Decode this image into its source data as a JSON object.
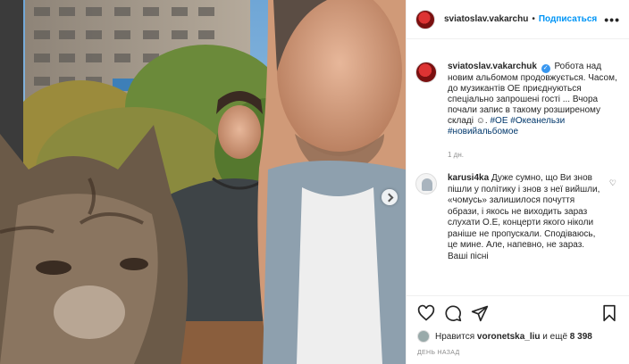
{
  "post": {
    "username": "sviatoslav.vakarchuk",
    "header_username": "sviatoslav.vakarchu",
    "follow_label": "Подписаться",
    "separator": "•",
    "more_label": "•••"
  },
  "caption": {
    "username": "sviatoslav.vakarchuk",
    "verified_glyph": "✓",
    "text": "Робота над новим альбомом продовжується. Часом, до музикантів ОЕ приєднуються спеціально запрошені гості ... Вчора почали запис в такому розширеному складі ☺.",
    "tag1": "#ОЕ",
    "tag2": "#Океанельзи",
    "tag3": "#новийальбомое",
    "time": "1 дн."
  },
  "comment": {
    "username": "karusi4ka",
    "text": "Дуже сумно, що Ви знов пішли у політику і знов з неї вийшли, «чомусь» залишилося почуття образи, і якось не виходить зараз слухати О.Е, концерти якого ніколи раніше не пропускали. Сподіваюсь, це мине. Але, напевно, не зараз. Ваші пісні",
    "like_glyph": "♡"
  },
  "likes": {
    "prefix": "Нравится",
    "user": "voronetska_liu",
    "middle": "и ещё",
    "count": "8 398"
  },
  "date": "ДЕНЬ НАЗАД",
  "icons": [
    "heart-icon",
    "comment-icon",
    "share-icon",
    "bookmark-icon",
    "next-arrow-icon"
  ]
}
